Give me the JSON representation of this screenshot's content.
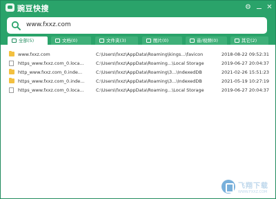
{
  "app": {
    "title": "豌豆快搜",
    "gear_glyph": "⚙",
    "close_glyph": "✕"
  },
  "search": {
    "value": "www.fxxz.com"
  },
  "tabs": [
    {
      "label": "全部(5)",
      "icon": "grid-icon",
      "active": true
    },
    {
      "label": "文档(0)",
      "icon": "document-icon",
      "active": false
    },
    {
      "label": "文件夹(3)",
      "icon": "folder-icon",
      "active": false
    },
    {
      "label": "图片(0)",
      "icon": "image-icon",
      "active": false
    },
    {
      "label": "音/视频(0)",
      "icon": "media-icon",
      "active": false
    },
    {
      "label": "其它(2)",
      "icon": "other-icon",
      "active": false
    }
  ],
  "results": [
    {
      "type": "folder",
      "name": "www.fxxz.com",
      "path": "C:\\Users\\fxxz\\AppData\\Roaming\\kings...\\favicon",
      "time": "2018-08-22 09:52:31"
    },
    {
      "type": "file",
      "name": "https_www.fxxz.com_0.loca...",
      "path": "C:\\Users\\fxxz\\AppData\\Roaming...\\Local Storage",
      "time": "2019-06-27 20:04:37"
    },
    {
      "type": "folder",
      "name": "http_www.fxxz.com_0.inde...",
      "path": "C:\\Users\\fxxz\\AppData\\Roaming\\3...\\IndexedDB",
      "time": "2021-02-26 15:51:23"
    },
    {
      "type": "folder",
      "name": "https_www.fxxz.com_0.inde...",
      "path": "C:\\Users\\fxxz\\AppData\\Roaming\\3...\\IndexedDB",
      "time": "2021-05-19 10:27:19"
    },
    {
      "type": "file",
      "name": "https_www.fxxz.com_0.loca...",
      "path": "C:\\Users\\fxxz\\AppData\\Roaming...\\Local Storage",
      "time": "2019-06-27 20:04:37"
    }
  ],
  "watermark": {
    "text": "飞翔下载",
    "url": "WWW.FXXZ.COM"
  },
  "colors": {
    "brand": "#2aa36a",
    "folder": "#f3c040"
  }
}
